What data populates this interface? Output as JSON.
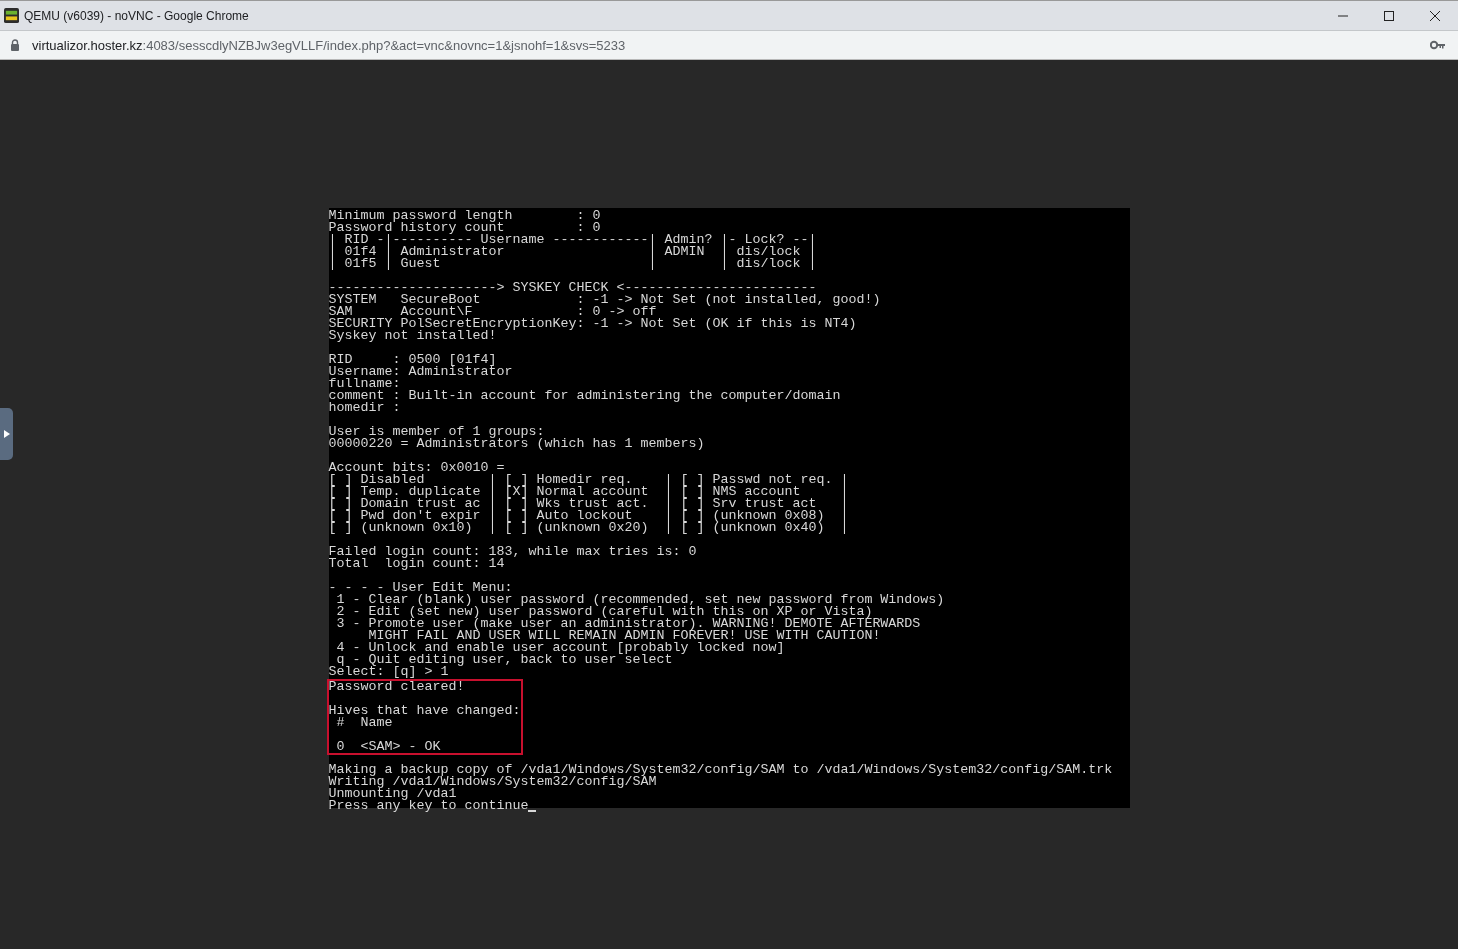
{
  "window": {
    "title": "QEMU (v6039) - noVNC - Google Chrome"
  },
  "address_bar": {
    "host": "virtualizor.hoster.kz",
    "path": ":4083/sesscdlyNZBJw3egVLLF/index.php?&act=vnc&novnc=1&jsnohf=1&svs=5233"
  },
  "terminal": {
    "cursor": true,
    "sections": [
      {
        "highlighted": false,
        "lines": [
          {
            "text": "Minimum password length        : 0",
            "gap_before": false
          },
          {
            "text": "Password history count         : 0",
            "gap_before": false
          },
          {
            "text": "| RID -|---------- Username ------------| Admin? |- Lock? --|",
            "gap_before": false
          },
          {
            "text": "| 01f4 | Administrator                  | ADMIN  | dis/lock |",
            "gap_before": false
          },
          {
            "text": "| 01f5 | Guest                          |        | dis/lock |",
            "gap_before": false
          },
          {
            "text": "---------------------> SYSKEY CHECK <------------------------",
            "gap_before": true
          },
          {
            "text": "SYSTEM   SecureBoot            : -1 -> Not Set (not installed, good!)",
            "gap_before": false
          },
          {
            "text": "SAM      Account\\F             : 0 -> off",
            "gap_before": false
          },
          {
            "text": "SECURITY PolSecretEncryptionKey: -1 -> Not Set (OK if this is NT4)",
            "gap_before": false
          },
          {
            "text": "Syskey not installed!",
            "gap_before": false
          },
          {
            "text": "RID     : 0500 [01f4]",
            "gap_before": true
          },
          {
            "text": "Username: Administrator",
            "gap_before": false
          },
          {
            "text": "fullname:",
            "gap_before": false
          },
          {
            "text": "comment : Built-in account for administering the computer/domain",
            "gap_before": false
          },
          {
            "text": "homedir :",
            "gap_before": false
          },
          {
            "text": "User is member of 1 groups:",
            "gap_before": true
          },
          {
            "text": "00000220 = Administrators (which has 1 members)",
            "gap_before": false
          },
          {
            "text": "Account bits: 0x0010 =",
            "gap_before": true
          },
          {
            "text": "[ ] Disabled        | [ ] Homedir req.    | [ ] Passwd not req. |",
            "gap_before": false
          },
          {
            "text": "[ ] Temp. duplicate | [X] Normal account  | [ ] NMS account     |",
            "gap_before": false
          },
          {
            "text": "[ ] Domain trust ac | [ ] Wks trust act.  | [ ] Srv trust act   |",
            "gap_before": false
          },
          {
            "text": "[ ] Pwd don't expir | [ ] Auto lockout    | [ ] (unknown 0x08)  |",
            "gap_before": false
          },
          {
            "text": "[ ] (unknown 0x10)  | [ ] (unknown 0x20)  | [ ] (unknown 0x40)  |",
            "gap_before": false
          },
          {
            "text": "Failed login count: 183, while max tries is: 0",
            "gap_before": true
          },
          {
            "text": "Total  login count: 14",
            "gap_before": false
          },
          {
            "text": "- - - - User Edit Menu:",
            "gap_before": true
          },
          {
            "text": " 1 - Clear (blank) user password (recommended, set new password from Windows)",
            "gap_before": false
          },
          {
            "text": " 2 - Edit (set new) user password (careful with this on XP or Vista)",
            "gap_before": false
          },
          {
            "text": " 3 - Promote user (make user an administrator). WARNING! DEMOTE AFTERWARDS",
            "gap_before": false
          },
          {
            "text": "     MIGHT FAIL AND USER WILL REMAIN ADMIN FOREVER! USE WITH CAUTION!",
            "gap_before": false
          },
          {
            "text": " 4 - Unlock and enable user account [probably locked now]",
            "gap_before": false
          },
          {
            "text": " q - Quit editing user, back to user select",
            "gap_before": false
          },
          {
            "text": "Select: [q] > 1",
            "gap_before": false
          }
        ]
      },
      {
        "highlighted": true,
        "lines": [
          {
            "text": "Password cleared!",
            "gap_before": false
          },
          {
            "text": "Hives that have changed:",
            "gap_before": true
          },
          {
            "text": " #  Name",
            "gap_before": false
          },
          {
            "text": " 0  <SAM> - OK",
            "gap_before": true
          }
        ]
      },
      {
        "highlighted": false,
        "lines": [
          {
            "text": "Making a backup copy of /vda1/Windows/System32/config/SAM to /vda1/Windows/System32/config/SAM.trk",
            "gap_before": true
          },
          {
            "text": "Writing /vda1/Windows/System32/config/SAM",
            "gap_before": false
          },
          {
            "text": "Unmounting /vda1",
            "gap_before": false
          },
          {
            "text": "Press any key to continue",
            "gap_before": false
          }
        ]
      }
    ]
  }
}
